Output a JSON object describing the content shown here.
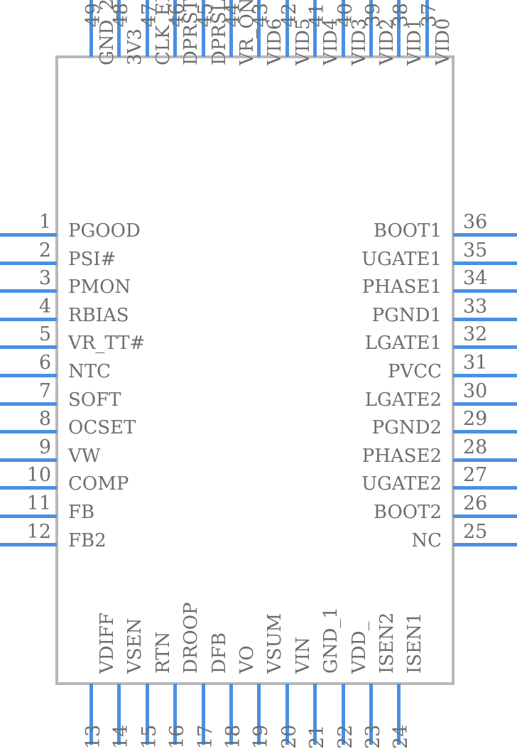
{
  "diagram": {
    "type": "ic-pinout",
    "package_pin_count": 49,
    "colors": {
      "pin_line": "#4a90e2",
      "body_border": "#b8b8b8",
      "text": "#6e6e6e",
      "background": "#ffffff"
    }
  },
  "pins": {
    "left": [
      {
        "number": "1",
        "label": "PGOOD"
      },
      {
        "number": "2",
        "label": "PSI#"
      },
      {
        "number": "3",
        "label": "PMON"
      },
      {
        "number": "4",
        "label": "RBIAS"
      },
      {
        "number": "5",
        "label": "VR_TT#"
      },
      {
        "number": "6",
        "label": "NTC"
      },
      {
        "number": "7",
        "label": "SOFT"
      },
      {
        "number": "8",
        "label": "OCSET"
      },
      {
        "number": "9",
        "label": "VW"
      },
      {
        "number": "10",
        "label": "COMP"
      },
      {
        "number": "11",
        "label": "FB"
      },
      {
        "number": "12",
        "label": "FB2"
      }
    ],
    "bottom": [
      {
        "number": "13",
        "label": "VDIFF"
      },
      {
        "number": "14",
        "label": "VSEN"
      },
      {
        "number": "15",
        "label": "RTN"
      },
      {
        "number": "16",
        "label": "DROOP"
      },
      {
        "number": "17",
        "label": "DFB"
      },
      {
        "number": "18",
        "label": "VO"
      },
      {
        "number": "19",
        "label": "VSUM"
      },
      {
        "number": "20",
        "label": "VIN"
      },
      {
        "number": "21",
        "label": "GND_1"
      },
      {
        "number": "22",
        "label": "VDD_"
      },
      {
        "number": "23",
        "label": "ISEN2"
      },
      {
        "number": "24",
        "label": "ISEN1"
      }
    ],
    "right": [
      {
        "number": "25",
        "label": "NC"
      },
      {
        "number": "26",
        "label": "BOOT2"
      },
      {
        "number": "27",
        "label": "UGATE2"
      },
      {
        "number": "28",
        "label": "PHASE2"
      },
      {
        "number": "29",
        "label": "PGND2"
      },
      {
        "number": "30",
        "label": "LGATE2"
      },
      {
        "number": "31",
        "label": "PVCC"
      },
      {
        "number": "32",
        "label": "LGATE1"
      },
      {
        "number": "33",
        "label": "PGND1"
      },
      {
        "number": "34",
        "label": "PHASE1"
      },
      {
        "number": "35",
        "label": "UGATE1"
      },
      {
        "number": "36",
        "label": "BOOT1"
      }
    ],
    "top": [
      {
        "number": "37",
        "label": "VID0"
      },
      {
        "number": "38",
        "label": "VID1"
      },
      {
        "number": "39",
        "label": "VID2"
      },
      {
        "number": "40",
        "label": "VID3"
      },
      {
        "number": "41",
        "label": "VID4"
      },
      {
        "number": "42",
        "label": "VID5"
      },
      {
        "number": "43",
        "label": "VID6"
      },
      {
        "number": "44",
        "label": "VR_ON"
      },
      {
        "number": "45",
        "label": "DPRSLPVR"
      },
      {
        "number": "46",
        "label": "DPRSTP#"
      },
      {
        "number": "47",
        "label": "CLK_EN#"
      },
      {
        "number": "48",
        "label": "3V3"
      },
      {
        "number": "49",
        "label": "GND_2"
      }
    ]
  }
}
